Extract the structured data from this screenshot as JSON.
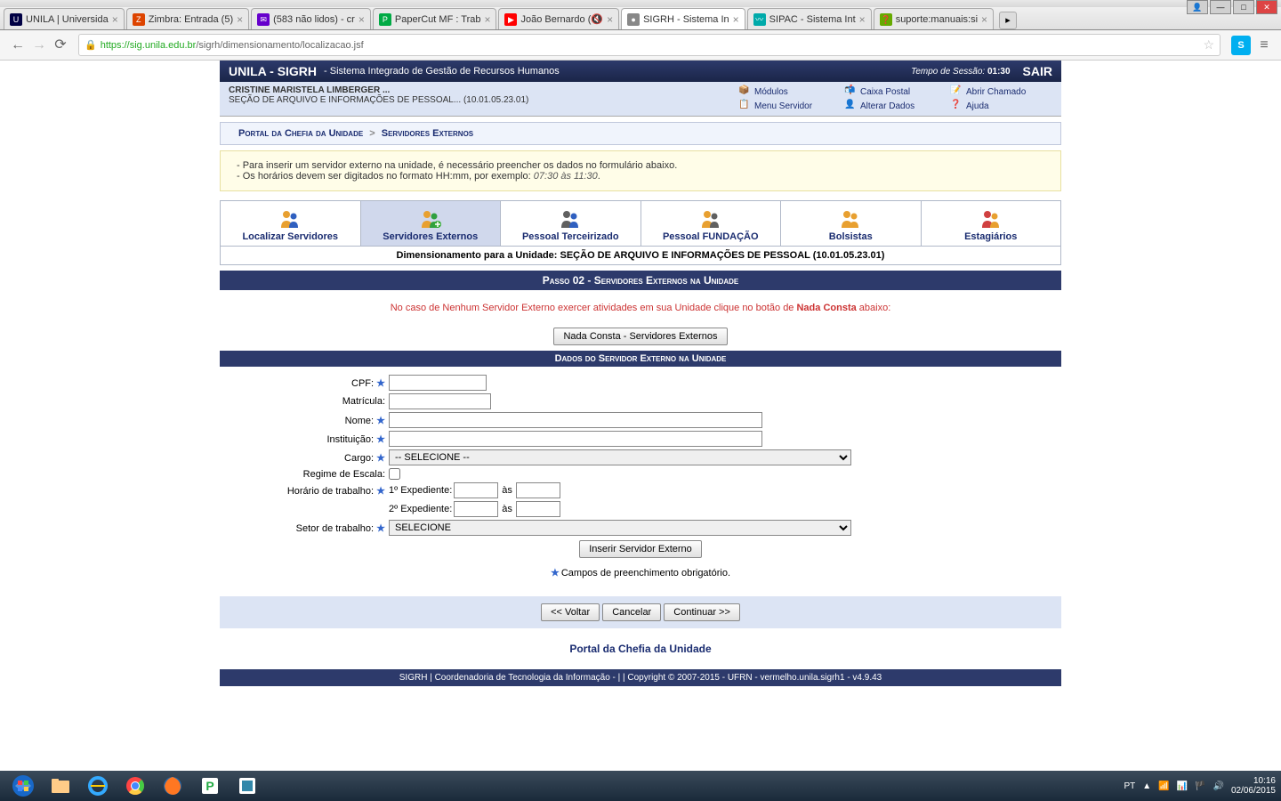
{
  "window": {
    "controls": {
      "min": "—",
      "max": "□",
      "close": "✕"
    },
    "menu_user": "👤"
  },
  "tabs": [
    {
      "title": "UNILA | Universida",
      "favicon": "U",
      "favcolor": "#004",
      "active": false
    },
    {
      "title": "Zimbra: Entrada (5)",
      "favicon": "Z",
      "favcolor": "#d40",
      "active": false
    },
    {
      "title": "(583 não lidos) - cr",
      "favicon": "✉",
      "favcolor": "#60c",
      "active": false
    },
    {
      "title": "PaperCut MF : Trab",
      "favicon": "P",
      "favcolor": "#0a4",
      "active": false
    },
    {
      "title": "João Bernardo (🔇",
      "favicon": "▶",
      "favcolor": "#f00",
      "active": false
    },
    {
      "title": "SIGRH - Sistema In",
      "favicon": "●",
      "favcolor": "#888",
      "active": true
    },
    {
      "title": "SIPAC - Sistema Int",
      "favicon": "〰",
      "favcolor": "#0aa",
      "active": false
    },
    {
      "title": "suporte:manuais:si",
      "favicon": "❓",
      "favcolor": "#6a0",
      "active": false
    }
  ],
  "url": {
    "https": "https",
    "host": "://sig.unila.edu.br",
    "path": "/sigrh/dimensionamento/localizacao.jsf"
  },
  "header": {
    "system": "UNILA - SIGRH",
    "desc": "- Sistema Integrado de Gestão de Recursos Humanos",
    "session_lbl": "Tempo de Sessão:",
    "session_val": "01:30",
    "logout": "SAIR"
  },
  "user": {
    "name": "CRISTINE MARISTELA LIMBERGER ...",
    "dept": "SEÇÃO DE ARQUIVO E INFORMAÇÕES DE PESSOAL... (10.01.05.23.01)"
  },
  "tools": {
    "modulos": "Módulos",
    "caixa": "Caixa Postal",
    "chamado": "Abrir Chamado",
    "menu": "Menu Servidor",
    "alterar": "Alterar Dados",
    "ajuda": "Ajuda"
  },
  "breadcrumb": {
    "a": "Portal da Chefia da Unidade",
    "sep": ">",
    "b": "Servidores Externos"
  },
  "info": {
    "l1": "- Para inserir um servidor externo na unidade, é necessário preencher os dados no formulário abaixo.",
    "l2a": "- Os horários devem ser digitados no formato HH:mm, por exemplo: ",
    "l2b": "07:30 às 11:30",
    "l2c": "."
  },
  "nav_tabs": [
    {
      "label": "Localizar Servidores",
      "color1": "#e8a030",
      "color2": "#3060c0"
    },
    {
      "label": "Servidores Externos",
      "color1": "#e8a030",
      "color2": "#30a040",
      "active": true
    },
    {
      "label": "Pessoal Terceirizado",
      "color1": "#606060",
      "color2": "#3060c0"
    },
    {
      "label": "Pessoal FUNDAÇÃO",
      "color1": "#e8a030",
      "color2": "#606060"
    },
    {
      "label": "Bolsistas",
      "color1": "#e8a030",
      "color2": "#e8a030"
    },
    {
      "label": "Estagiários",
      "color1": "#d04040",
      "color2": "#e8a030"
    }
  ],
  "dim_line": "Dimensionamento para a Unidade: SEÇÃO DE ARQUIVO E INFORMAÇÕES DE PESSOAL (10.01.05.23.01)",
  "step_hdr": "Passo 02 - Servidores Externos na Unidade",
  "warn": {
    "pre": "No caso de Nenhum Servidor Externo exercer atividades em sua Unidade clique no botão de ",
    "b": "Nada Consta",
    "post": " abaixo:"
  },
  "buttons": {
    "nada_consta": "Nada Consta - Servidores Externos",
    "inserir": "Inserir Servidor Externo",
    "voltar": "<< Voltar",
    "cancelar": "Cancelar",
    "continuar": "Continuar >>"
  },
  "sub_hdr": "Dados do Servidor Externo na Unidade",
  "form": {
    "cpf": "CPF:",
    "matricula": "Matrícula:",
    "nome": "Nome:",
    "instituicao": "Instituição:",
    "cargo": "Cargo:",
    "cargo_opt": "-- SELECIONE --",
    "regime": "Regime de Escala:",
    "horario": "Horário de trabalho:",
    "exp1": "1º Expediente:",
    "exp2": "2º Expediente:",
    "as": "às",
    "setor": "Setor de trabalho:",
    "setor_opt": "SELECIONE",
    "req_note": "Campos de preenchimento obrigatório."
  },
  "portal_link": "Portal da Chefia da Unidade",
  "footer": "SIGRH | Coordenadoria de Tecnologia da Informação - | | Copyright © 2007-2015 - UFRN - vermelho.unila.sigrh1 - v4.9.43",
  "taskbar": {
    "lang": "PT",
    "time": "10:16",
    "date": "02/06/2015"
  }
}
